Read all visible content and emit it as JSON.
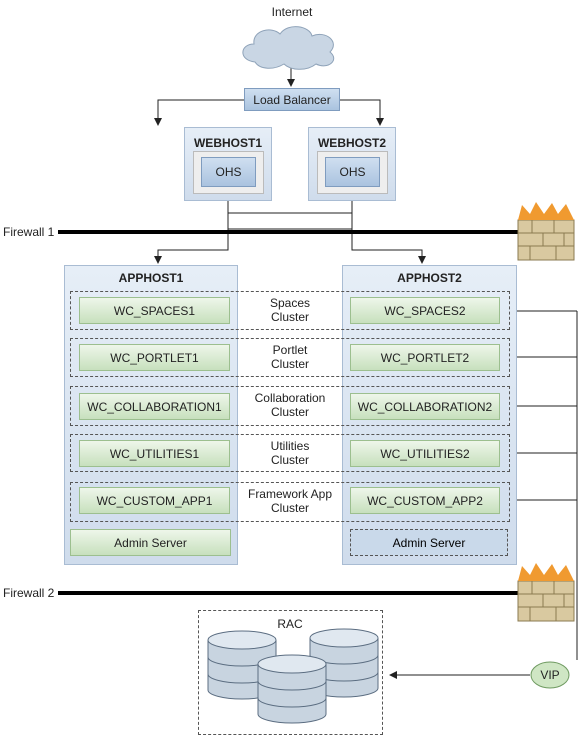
{
  "internet": {
    "label": "Internet"
  },
  "load_balancer": {
    "label": "Load Balancer"
  },
  "webhosts": [
    {
      "title": "WEBHOST1",
      "component": "OHS"
    },
    {
      "title": "WEBHOST2",
      "component": "OHS"
    }
  ],
  "firewalls": [
    {
      "label": "Firewall 1"
    },
    {
      "label": "Firewall 2"
    }
  ],
  "apphosts": [
    {
      "title": "APPHOST1",
      "servers": [
        "WC_SPACES1",
        "WC_PORTLET1",
        "WC_COLLABORATION1",
        "WC_UTILITIES1",
        "WC_CUSTOM_APP1"
      ],
      "admin": "Admin Server"
    },
    {
      "title": "APPHOST2",
      "servers": [
        "WC_SPACES2",
        "WC_PORTLET2",
        "WC_COLLABORATION2",
        "WC_UTILITIES2",
        "WC_CUSTOM_APP2"
      ],
      "admin": "Admin Server"
    }
  ],
  "clusters": [
    {
      "line1": "Spaces",
      "line2": "Cluster"
    },
    {
      "line1": "Portlet",
      "line2": "Cluster"
    },
    {
      "line1": "Collaboration",
      "line2": "Cluster"
    },
    {
      "line1": "Utilities",
      "line2": "Cluster"
    },
    {
      "line1": "Framework App",
      "line2": "Cluster"
    }
  ],
  "database": {
    "label": "RAC",
    "vip": "VIP"
  },
  "colors": {
    "host": "#d8e4f0",
    "server": "#d6e9ce",
    "firewall": "#e8a040"
  }
}
